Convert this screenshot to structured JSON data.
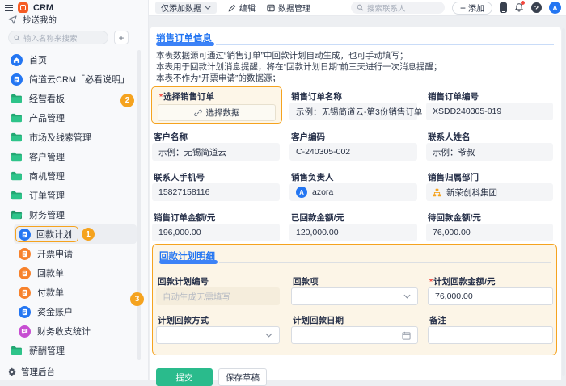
{
  "required_mark": "*",
  "colors": {
    "accent_blue": "#2476F2",
    "brand_orange": "#F55B23",
    "highlight_orange": "#F5A31F",
    "folder_green": "#2EC48A",
    "icon_orange": "#F7822C",
    "icon_magenta": "#C74ED2",
    "submit_green": "#2ABB8C",
    "notification_red": "#F2483F"
  },
  "topbar": {
    "brand": "CRM",
    "mode_button": "仅添加数据",
    "edit_button": "编辑",
    "data_manage_button": "数据管理",
    "search_placeholder": "搜索联系人",
    "add_button": "添加",
    "avatar_letter": "A"
  },
  "sidebar": {
    "copy_to_me": "抄送我的",
    "search_placeholder": "输入名称来搜索",
    "items": [
      {
        "label": "首页"
      },
      {
        "label": "简道云CRM「必看说明」"
      },
      {
        "label": "经营看板"
      },
      {
        "label": "产品管理"
      },
      {
        "label": "市场及线索管理"
      },
      {
        "label": "客户管理"
      },
      {
        "label": "商机管理"
      },
      {
        "label": "订单管理"
      },
      {
        "label": "财务管理"
      },
      {
        "label": "回款计划"
      },
      {
        "label": "开票申请"
      },
      {
        "label": "回款单"
      },
      {
        "label": "付款单"
      },
      {
        "label": "资金账户"
      },
      {
        "label": "财务收支统计"
      },
      {
        "label": "薪酬管理"
      }
    ],
    "footer": "管理后台"
  },
  "main": {
    "section1": {
      "title": "销售订单信息",
      "notes": [
        "本表数据源可通过“销售订单”中回款计划自动生成，也可手动填写；",
        "本表用于回款计划消息提醒，将在“回款计划日期”前三天进行一次消息提醒；",
        "本表不作为“开票申请”的数据源；"
      ],
      "select_order": {
        "label": "选择销售订单",
        "button": "选择数据"
      },
      "order_name": {
        "label": "销售订单名称",
        "value": "示例：无锡简道云-第3份销售订单"
      },
      "order_no": {
        "label": "销售订单编号",
        "value": "XSDD240305-019"
      },
      "customer_name": {
        "label": "客户名称",
        "value": "示例：无锡简道云"
      },
      "customer_code": {
        "label": "客户编码",
        "value": "C-240305-002"
      },
      "contact_name": {
        "label": "联系人姓名",
        "value": "示例：爷叔"
      },
      "contact_phone": {
        "label": "联系人手机号",
        "value": "15827158116"
      },
      "sales_owner": {
        "label": "销售负责人",
        "value": "azora",
        "avatar": "A"
      },
      "sales_dept": {
        "label": "销售归属部门",
        "value": "新荣创科集团"
      },
      "order_amount": {
        "label": "销售订单金额/元",
        "value": "196,000.00"
      },
      "received_amount": {
        "label": "已回款金额/元",
        "value": "120,000.00"
      },
      "pending_amount": {
        "label": "待回款金额/元",
        "value": "76,000.00"
      }
    },
    "section2": {
      "title": "回款计划明细",
      "plan_no": {
        "label": "回款计划编号",
        "placeholder": "自动生成无需填写"
      },
      "plan_item": {
        "label": "回款项"
      },
      "plan_amount": {
        "label": "计划回款金额/元",
        "value": "76,000.00"
      },
      "plan_method": {
        "label": "计划回款方式"
      },
      "plan_date": {
        "label": "计划回款日期"
      },
      "remark": {
        "label": "备注"
      }
    },
    "submit_button": "提交",
    "save_draft_button": "保存草稿"
  },
  "annotations": [
    "1",
    "2",
    "3"
  ]
}
